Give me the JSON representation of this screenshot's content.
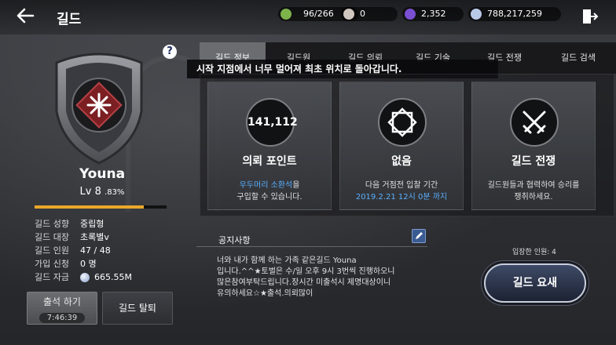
{
  "header": {
    "back_icon": "arrow-left-icon",
    "title": "길드",
    "resources": [
      {
        "icon": "stamina-icon",
        "color": "#7db34a",
        "value": "96/266"
      },
      {
        "icon": "pearl-icon",
        "color": "#cfc6c0",
        "value": "0"
      },
      {
        "icon": "crystal-icon",
        "color": "#7a4fd1",
        "value": "2,352"
      },
      {
        "icon": "silver-coin-icon",
        "color": "#b9c9e8",
        "value": "788,217,259"
      }
    ],
    "exit_icon": "exit-door-icon"
  },
  "guild": {
    "name": "Youna",
    "level": "Lv 8",
    "level_percent": ".83%",
    "xp_fraction": 0.83,
    "info": [
      {
        "label": "길드 성향",
        "value": "중립형"
      },
      {
        "label": "길드 대장",
        "value": "초록별v"
      },
      {
        "label": "길드 인원",
        "value": "47 / 48"
      },
      {
        "label": "가입 신청",
        "value": "0 명"
      },
      {
        "label": "길드 자금",
        "value": "665.55M"
      }
    ],
    "attend_label": "출석 하기",
    "attend_timer": "7:46:39",
    "leave_label": "길드 탈퇴",
    "help_label": "?"
  },
  "tabs": [
    {
      "label": "길드 정보",
      "active": true
    },
    {
      "label": "길드원",
      "active": false
    },
    {
      "label": "길드 의뢰",
      "active": false
    },
    {
      "label": "길드 기술",
      "active": false
    },
    {
      "label": "길드 전쟁",
      "active": false
    },
    {
      "label": "길드 검색",
      "active": false
    }
  ],
  "toast": "시작 지점에서 너무 멀어져 최초 위치로 돌아갑니다.",
  "cards": [
    {
      "emblem": "141,112",
      "title": "의뢰 포인트",
      "desc_blue": "우두머리 소환석",
      "desc_1": "을",
      "desc_2": "구입할 수 있습니다."
    },
    {
      "emblem_icon": "cube-icon",
      "title": "없음",
      "desc_1": "다음 거점전 입찰 기간",
      "desc_blue": "2019.2.21 12시 0분 까지"
    },
    {
      "emblem_icon": "crossed-swords-icon",
      "title": "길드 전쟁",
      "desc_1": "길드원들과 협력하여 승리를",
      "desc_2": "쟁취하세요."
    }
  ],
  "notice": {
    "label": "공지사항",
    "text": "너와 내가 함께 하는 가족 같은길드 Youna\n입니다.^^★토벌은 수/일 오후 9시 3번씩 진행하오니\n많은참여부탁드립니다.장시간 미출석시 제명대상이니\n유의하세요☆★출석.의뢰많이"
  },
  "members_label": "입장한 인원: 4",
  "request_label": "길드 요새",
  "colors": {
    "accent_blue": "#5ab0ff",
    "xp": "#e9a72a"
  }
}
